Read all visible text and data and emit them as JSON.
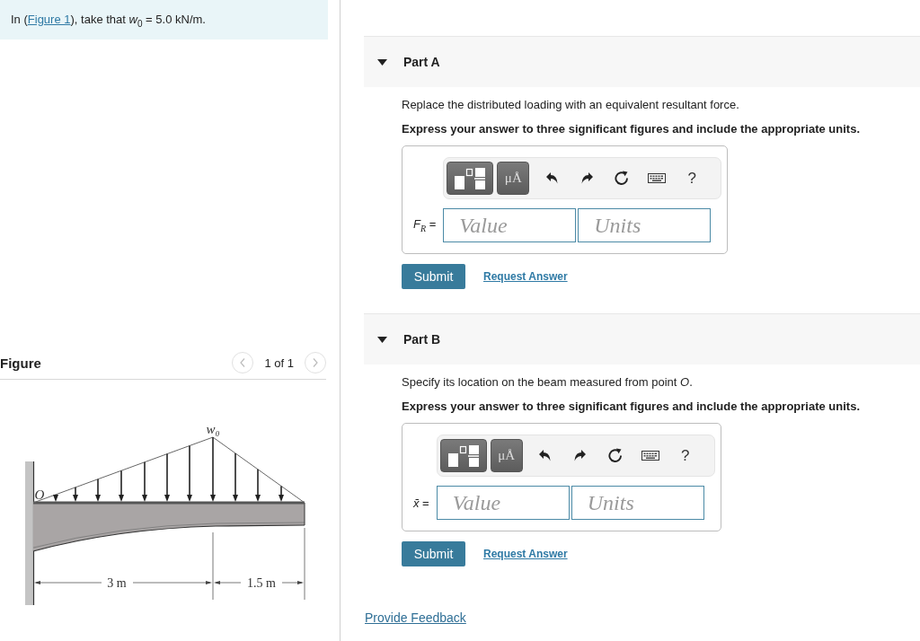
{
  "statement": {
    "before": "In (",
    "link": "Figure 1",
    "after": "), take that *w*$_{0}$ = 5.0 kN/m."
  },
  "figure": {
    "title": "Figure",
    "pager": {
      "prev": {
        "disabled": true
      },
      "text": "1 of 1",
      "next": {
        "disabled": true
      }
    },
    "diagram": {
      "labels": [
        {
          "kind": "load",
          "text": "w₀"
        },
        {
          "kind": "origin",
          "text": "O"
        },
        {
          "kind": "span_left",
          "text": "3 m"
        },
        {
          "kind": "span_right",
          "text": "1.5 m"
        }
      ]
    }
  },
  "parts": [
    {
      "title": "Part A",
      "expanded": true,
      "prompt": "Replace the distributed loading with an equivalent resultant force.",
      "instruction": "Express your answer to three significant figures and include the appropriate units.",
      "toolbar": [
        {
          "kind": "templates"
        },
        {
          "kind": "units",
          "label": "μÅ"
        },
        {
          "kind": "undo"
        },
        {
          "kind": "redo"
        },
        {
          "kind": "reset"
        },
        {
          "kind": "keyboard"
        },
        {
          "kind": "help",
          "label": "?"
        }
      ],
      "answer_label": "*F*$_{R}$ =",
      "value": {
        "placeholder": "Value"
      },
      "units": {
        "placeholder": "Units"
      },
      "submit": "Submit",
      "request": "Request Answer"
    },
    {
      "title": "Part B",
      "expanded": true,
      "prompt": "Specify its location on the beam measured from point *O*.",
      "instruction": "Express your answer to three significant figures and include the appropriate units.",
      "toolbar": [
        {
          "kind": "templates"
        },
        {
          "kind": "units",
          "label": "μÅ"
        },
        {
          "kind": "undo"
        },
        {
          "kind": "redo"
        },
        {
          "kind": "reset"
        },
        {
          "kind": "keyboard"
        },
        {
          "kind": "help",
          "label": "?"
        }
      ],
      "answer_label": "*x̄* =",
      "value": {
        "placeholder": "Value"
      },
      "units": {
        "placeholder": "Units"
      },
      "submit": "Submit",
      "request": "Request Answer"
    }
  ],
  "feedback_link": "Provide Feedback"
}
